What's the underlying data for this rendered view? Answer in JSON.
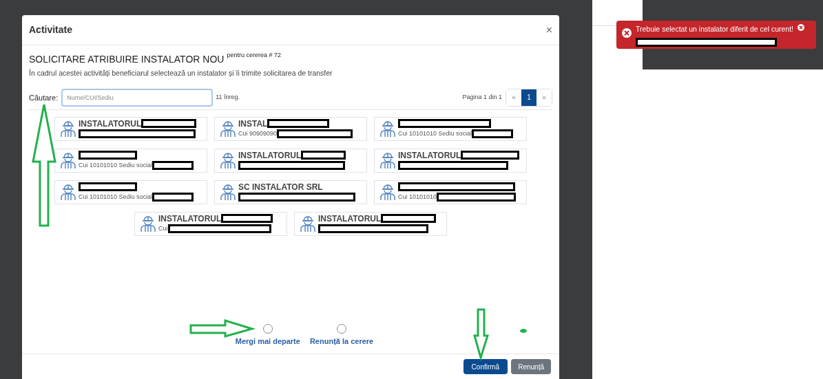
{
  "modal": {
    "title": "Activitate",
    "close": "×",
    "heading": "SOLICITARE ATRIBUIRE INSTALATOR NOU",
    "heading_note": "pentru cererea # 72",
    "description": "În cadrul acestei activități beneficiarul selectează un instalator și îi trimite solicitarea de transfer",
    "search": {
      "label": "Căutare:",
      "placeholder": "Nume/CUI/Sediu",
      "count": "11 înreg."
    },
    "pagination": {
      "info": "Pagina 1 din 1",
      "items": [
        {
          "label": "«",
          "selected": false
        },
        {
          "label": "1",
          "selected": true
        },
        {
          "label": "»",
          "selected": false
        }
      ]
    },
    "installers": [
      {
        "name": "INSTALATORUL"
      },
      {
        "name": "INSTAL",
        "sub": "Cui 90909090"
      },
      {
        "sub": "Cui 10101010 Sediu social"
      },
      {
        "sub": "Cui 10101010 Sediu social"
      },
      {
        "name": "INSTALATORUL"
      },
      {
        "name": "INSTALATORUL"
      },
      {
        "sub": "Cui 10101010 Sediu social"
      },
      {
        "name": "SC INSTALATOR SRL"
      },
      {
        "sub": "Cui 10101010"
      },
      {
        "name": "INSTALATORUL",
        "sub": "Cui"
      },
      {
        "name": "INSTALATORUL"
      }
    ],
    "options": [
      {
        "label": "Mergi mai departe",
        "selected": false
      },
      {
        "label": "Renunță la cerere",
        "selected": false
      }
    ],
    "buttons": [
      {
        "label": "Confirmă",
        "kind": "primary"
      },
      {
        "label": "Renunță",
        "kind": "secondary"
      }
    ]
  },
  "toast": {
    "message": "Trebuie selectat un instalator diferit de cel curent!"
  }
}
